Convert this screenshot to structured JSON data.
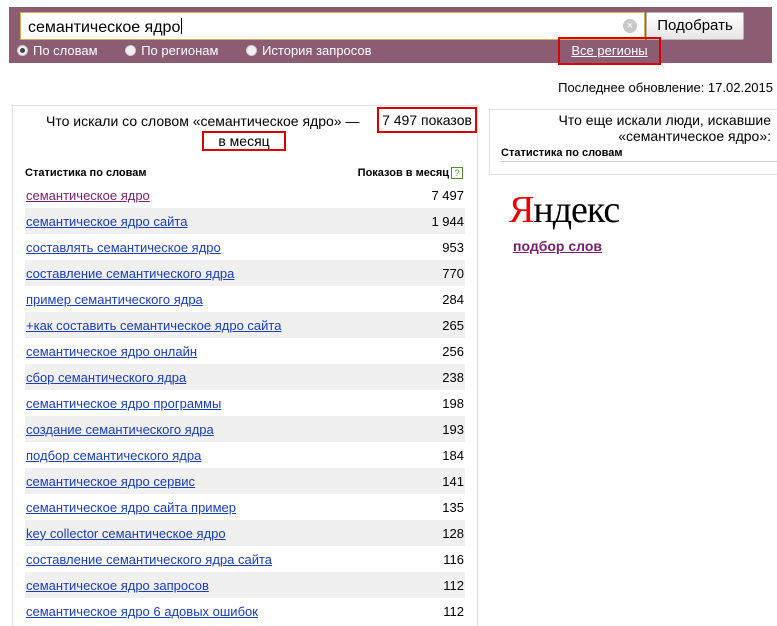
{
  "search": {
    "value": "семантическое ядро",
    "clear_icon": "×",
    "button_label": "Подобрать"
  },
  "radios": [
    {
      "label": "По словам",
      "selected": true
    },
    {
      "label": "По регионам",
      "selected": false
    },
    {
      "label": "История запросов",
      "selected": false
    }
  ],
  "regions_link": "Все регионы",
  "last_update": "Последнее обновление: 17.02.2015",
  "left_panel": {
    "heading": "Что искали со словом «семантическое ядро» —",
    "count": "7 497 показов",
    "per_month": "в месяц",
    "col_keyword": "Статистика по словам",
    "col_count": "Показов в месяц",
    "help_icon": "?",
    "rows": [
      {
        "keyword": "семантическое ядро",
        "count": "7 497"
      },
      {
        "keyword": "семантическое ядро сайта",
        "count": "1 944"
      },
      {
        "keyword": "составлять семантическое ядро",
        "count": "953"
      },
      {
        "keyword": "составление семантического ядра",
        "count": "770"
      },
      {
        "keyword": "пример семантического ядра",
        "count": "284"
      },
      {
        "keyword": "+как составить семантическое ядро сайта",
        "count": "265"
      },
      {
        "keyword": "семантическое ядро онлайн",
        "count": "256"
      },
      {
        "keyword": "сбор семантического ядра",
        "count": "238"
      },
      {
        "keyword": "семантическое ядро программы",
        "count": "198"
      },
      {
        "keyword": "создание семантического ядра",
        "count": "193"
      },
      {
        "keyword": "подбор семантического ядра",
        "count": "184"
      },
      {
        "keyword": "семантическое ядро сервис",
        "count": "141"
      },
      {
        "keyword": "семантическое ядро сайта пример",
        "count": "135"
      },
      {
        "keyword": "key collector семантическое ядро",
        "count": "128"
      },
      {
        "keyword": "составление семантического ядра сайта",
        "count": "116"
      },
      {
        "keyword": "семантическое ядро запросов",
        "count": "112"
      },
      {
        "keyword": "семантическое ядро 6 адовых ошибок",
        "count": "112"
      }
    ]
  },
  "right_panel": {
    "heading_line1": "Что еще искали люди, искавшие",
    "heading_line2": "«семантическое ядро»:",
    "col_keyword": "Статистика по словам"
  },
  "logo": {
    "first": "Я",
    "rest": "ндекс"
  },
  "wordstat_link": "подбор слов"
}
